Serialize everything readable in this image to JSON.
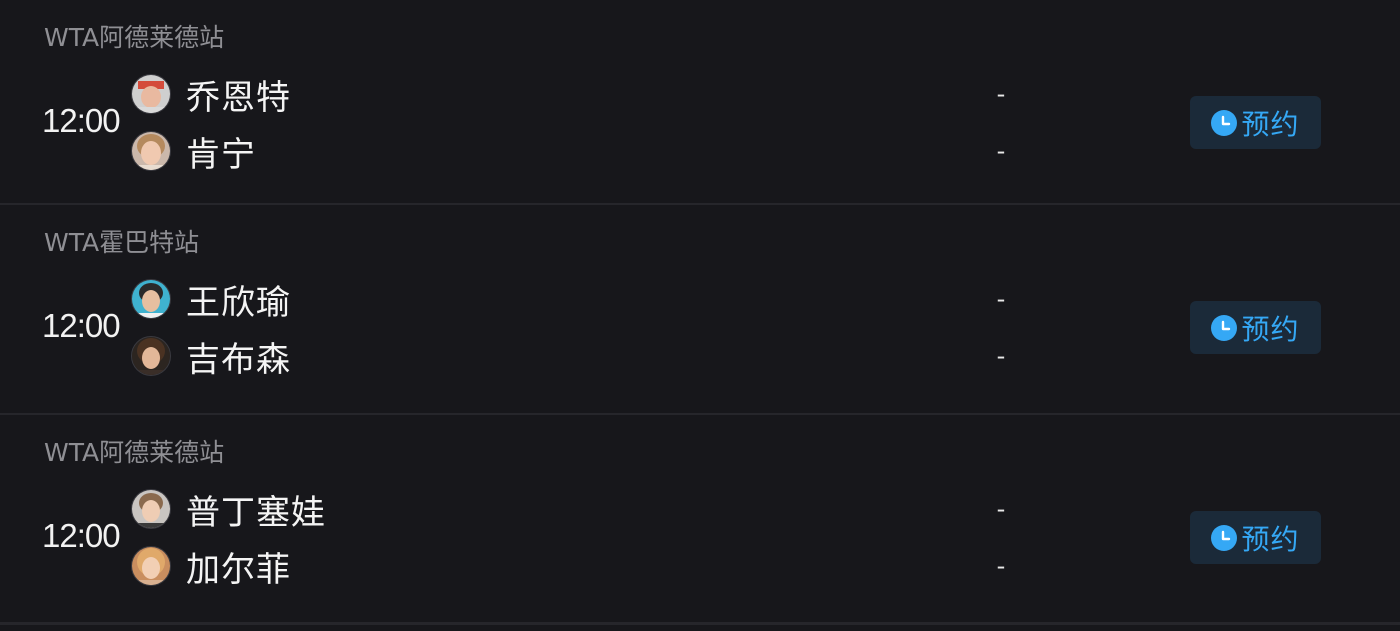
{
  "matches": [
    {
      "tournament": "WTA阿德莱德站",
      "time": "12:00",
      "players": [
        {
          "name": "乔恩特",
          "score": "-",
          "avatar": "player-avatar"
        },
        {
          "name": "肯宁",
          "score": "-",
          "avatar": "player-avatar"
        }
      ],
      "button_label": "预约"
    },
    {
      "tournament": "WTA霍巴特站",
      "time": "12:00",
      "players": [
        {
          "name": "王欣瑜",
          "score": "-",
          "avatar": "player-avatar"
        },
        {
          "name": "吉布森",
          "score": "-",
          "avatar": "player-avatar"
        }
      ],
      "button_label": "预约"
    },
    {
      "tournament": "WTA阿德莱德站",
      "time": "12:00",
      "players": [
        {
          "name": "普丁塞娃",
          "score": "-",
          "avatar": "player-avatar"
        },
        {
          "name": "加尔菲",
          "score": "-",
          "avatar": "player-avatar"
        }
      ],
      "button_label": "预约"
    }
  ],
  "colors": {
    "background": "#17171b",
    "accent": "#35a8f5",
    "button_bg": "#1b2a39",
    "muted_text": "#8f8f94"
  },
  "icons": {
    "remind": "clock-icon"
  }
}
